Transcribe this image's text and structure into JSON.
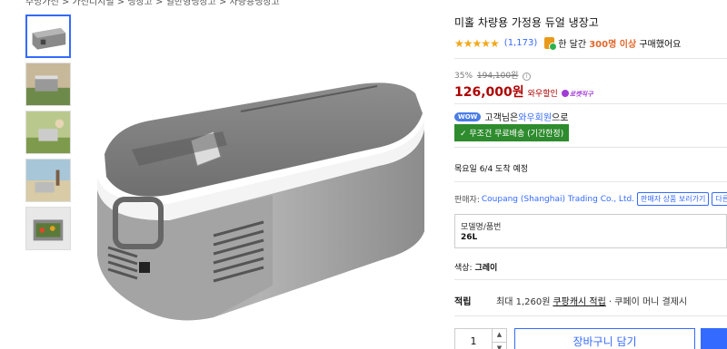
{
  "breadcrumb": "주방가전 > 가전디지털 > 냉장고 > 일반형냉장고 > 차량용냉장고",
  "product": {
    "title": "미홀 차량용 가정용 듀얼 냉장고",
    "stars": "★★★★★",
    "rating": 4.5,
    "review_count": "(1,173)",
    "buy_prefix": "한 달간",
    "buy_count": "300명 이상",
    "buy_suffix": "구매했어요"
  },
  "pricing": {
    "discount": "35%",
    "original_price": "194,100원",
    "info_icon": "ⓘ",
    "price": "126,000원",
    "wow_label": "와우할인",
    "rocket_badge": "로켓직구"
  },
  "member": {
    "badge": "WOW",
    "text_prefix": "고객님은",
    "text_link": "와우회원",
    "text_suffix": "으로"
  },
  "shipping": {
    "free_label": "✓ 무조건 무료배송 (기간한정)",
    "arrival": "목요일 6/4 도착 예정"
  },
  "seller": {
    "label": "판매자:",
    "name": "Coupang (Shanghai) Trading Co., Ltd.",
    "more_button": "판매자 상품 보러가기",
    "other_button": "다른"
  },
  "option": {
    "label": "모델명/품번",
    "value": "26L"
  },
  "color": {
    "label": "색상:",
    "value": "그레이"
  },
  "reward": {
    "label": "적립",
    "text": "최대 1,260원",
    "link": "쿠팡캐시 적립",
    "suffix": "· 쿠페이 머니 결제시"
  },
  "purchase": {
    "quantity": "1",
    "up": "▲",
    "down": "▼",
    "cart_label": "장바구니 담기"
  },
  "colors": {
    "accent": "#346aff",
    "price": "#ae0000",
    "free_ship": "#2e8b2e",
    "star": "#f2a71b"
  },
  "icons": {
    "info": "info-icon",
    "rocket": "rocket-badge-icon",
    "buy_count": "shopping-bag-icon"
  }
}
